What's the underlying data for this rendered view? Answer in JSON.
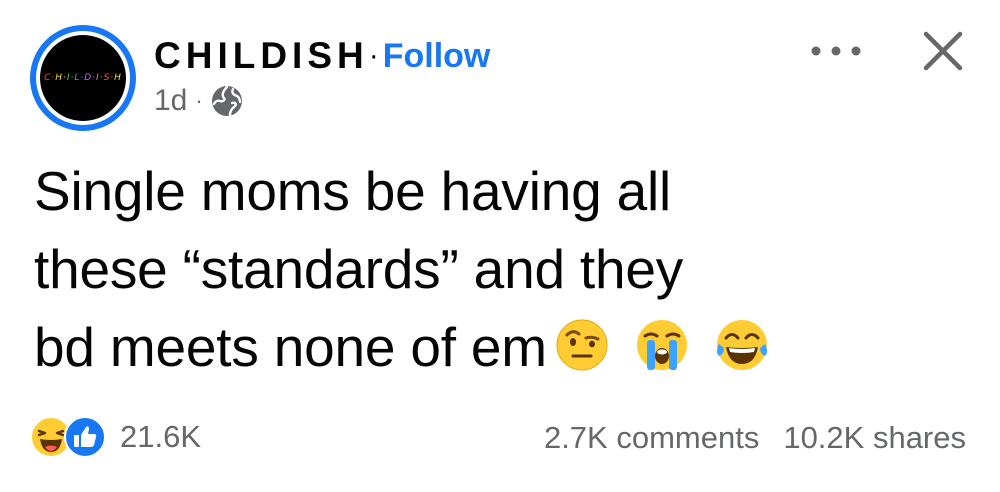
{
  "post": {
    "author": {
      "name": "CHILDISH",
      "avatar_text": "CHILDISH",
      "separator": "·",
      "follow_label": "Follow"
    },
    "meta": {
      "time": "1d",
      "separator": "·",
      "audience_icon": "globe-icon"
    },
    "text": {
      "line1": "Single moms be having all",
      "line2": "these “standards” and they",
      "line3": "bd meets none of em"
    },
    "emojis": [
      "raised-eyebrow-emoji",
      "crying-face-emoji",
      "tears-of-joy-emoji"
    ],
    "reactions": {
      "icons": [
        "haha-reaction-icon",
        "like-reaction-icon"
      ],
      "count": "21.6K"
    },
    "comments_label": "2.7K comments",
    "shares_label": "10.2K shares"
  },
  "controls": {
    "more_icon": "more-options-icon",
    "close_icon": "close-icon"
  },
  "colors": {
    "accent": "#1877f2",
    "text_primary": "#050505",
    "text_secondary": "#65676b",
    "background": "#ffffff",
    "emoji_yellow": "#ffcc33"
  }
}
